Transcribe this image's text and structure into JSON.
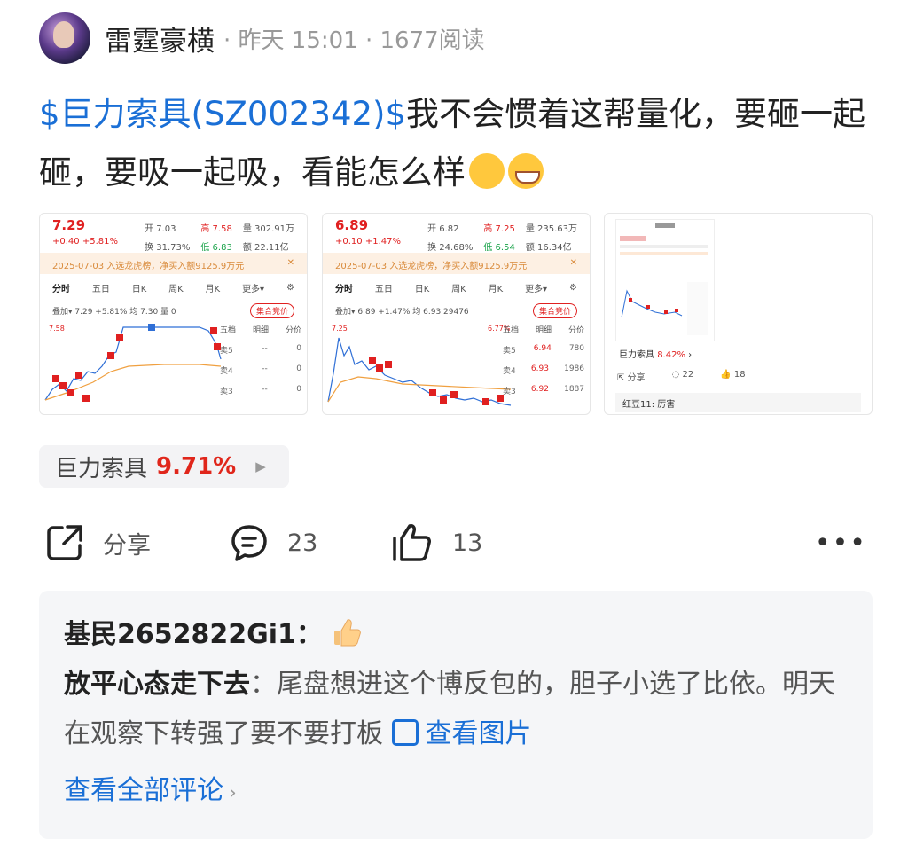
{
  "author": {
    "name": "雷霆豪横",
    "time": "· 昨天 15:01 · 1677阅读"
  },
  "post": {
    "stock_link": "$巨力索具(SZ002342)$",
    "text": "我不会惯着这帮量化，要砸一起砸，要吸一起吸，看能怎么样"
  },
  "thumbnails": [
    {
      "price": "7.29",
      "change": "+0.40  +5.81%",
      "stats": [
        "开 7.03",
        "高 7.58",
        "量 302.91万",
        "换 31.73%",
        "低 6.83",
        "额 22.11亿"
      ],
      "notice": "2025-07-03 入选龙虎榜，净买入额9125.9万元",
      "tabs": [
        "分时",
        "五日",
        "日K",
        "周K",
        "月K",
        "更多▾"
      ],
      "sub": "叠加▾  7.29 +5.81%  均 7.30  量 0",
      "badge": "集合竞价",
      "book_head": [
        "五档",
        "明细",
        "分价"
      ],
      "book": [
        [
          "卖5",
          "--",
          "0"
        ],
        [
          "卖4",
          "--",
          "0"
        ],
        [
          "卖3",
          "--",
          "0"
        ]
      ],
      "ymax": "7.58"
    },
    {
      "price": "6.89",
      "change": "+0.10  +1.47%",
      "stats": [
        "开 6.82",
        "高 7.25",
        "量 235.63万",
        "换 24.68%",
        "低 6.54",
        "额 16.34亿"
      ],
      "notice": "2025-07-03 入选龙虎榜，净买入额9125.9万元",
      "tabs": [
        "分时",
        "五日",
        "日K",
        "周K",
        "月K",
        "更多▾"
      ],
      "sub": "叠加▾  6.89 +1.47%  均 6.93  29476",
      "badge": "集合竞价",
      "book_head": [
        "五档",
        "明细",
        "分价"
      ],
      "book": [
        [
          "卖5",
          "6.94",
          "780"
        ],
        [
          "卖4",
          "6.93",
          "1986"
        ],
        [
          "卖3",
          "6.92",
          "1887"
        ]
      ],
      "ymax": "7.25"
    },
    {
      "name": "巨力索具",
      "pct": "8.42%",
      "share": "分享",
      "comments": "22",
      "likes": "18",
      "comment": "红豆11:  厉害"
    }
  ],
  "tag": {
    "name": "巨力索具",
    "pct": "9.71%"
  },
  "actions": {
    "share": "分享",
    "comments": "23",
    "likes": "13"
  },
  "comments": {
    "first_user": "基民2652822Gi1：",
    "second_user": "放平心态走下去",
    "second_text": "：尾盘想进这个博反包的，胆子小选了比依。明天在观察下转强了要不要打板",
    "view_image": "查看图片",
    "view_all": "查看全部评论"
  },
  "colors": {
    "link": "#1a6fd6",
    "up": "#e0261b",
    "down": "#1aa34a"
  }
}
